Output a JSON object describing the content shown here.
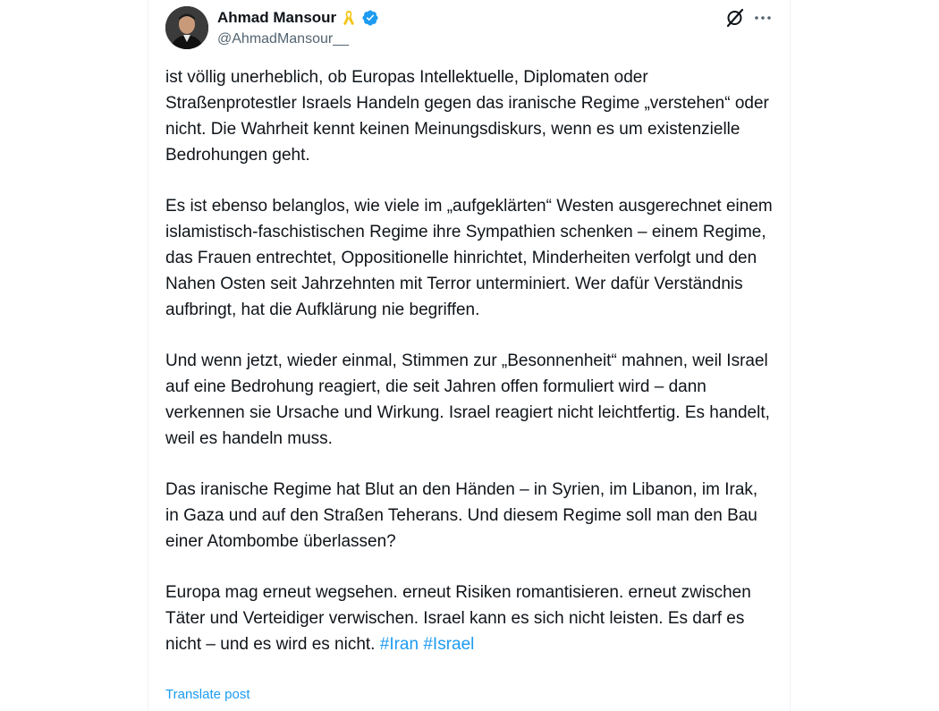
{
  "author": {
    "name": "Ahmad Mansour",
    "handle": "@AhmadMansour__",
    "badge_icon": "yellow-ribbon-icon",
    "verified_icon": "verified-badge-icon",
    "verified_color": "#1d9bf0",
    "ribbon_color": "#f5c518"
  },
  "actions": {
    "grok_icon": "grok-icon",
    "more_icon": "more-icon"
  },
  "tweet": {
    "paragraphs": [
      "ist völlig unerheblich, ob Europas Intellektuelle, Diplomaten oder Straßenprotestler Israels Handeln gegen das iranische Regime „verstehen“ oder nicht. Die Wahrheit kennt keinen Meinungsdiskurs, wenn es um existenzielle Bedrohungen geht.",
      "Es ist ebenso belanglos, wie viele im „aufgeklärten“ Westen ausgerechnet einem islamistisch-faschistischen Regime ihre Sympathien schenken – einem Regime, das Frauen entrechtet, Oppositionelle hinrichtet, Minderheiten verfolgt und den Nahen Osten seit Jahrzehnten mit Terror unterminiert. Wer dafür Verständnis aufbringt, hat die Aufklärung nie begriffen.",
      "Und wenn jetzt, wieder einmal, Stimmen zur „Besonnenheit“ mahnen, weil Israel auf eine Bedrohung reagiert, die seit Jahren offen formuliert wird – dann verkennen sie Ursache und Wirkung. Israel reagiert nicht leichtfertig. Es handelt, weil es handeln muss.",
      "Das iranische Regime hat Blut an den Händen – in Syrien, im Libanon, im Irak, in Gaza und auf den Straßen Teherans. Und diesem Regime soll man den Bau einer Atombombe überlassen?",
      "Europa mag erneut wegsehen. erneut Risiken romantisieren. erneut zwischen Täter und Verteidiger verwischen. Israel kann es sich nicht leisten. Es darf es nicht – und es wird es nicht."
    ],
    "hashtags": [
      "#Iran",
      "#Israel"
    ],
    "hashtag_color": "#1d9bf0"
  },
  "translate_label": "Translate post"
}
